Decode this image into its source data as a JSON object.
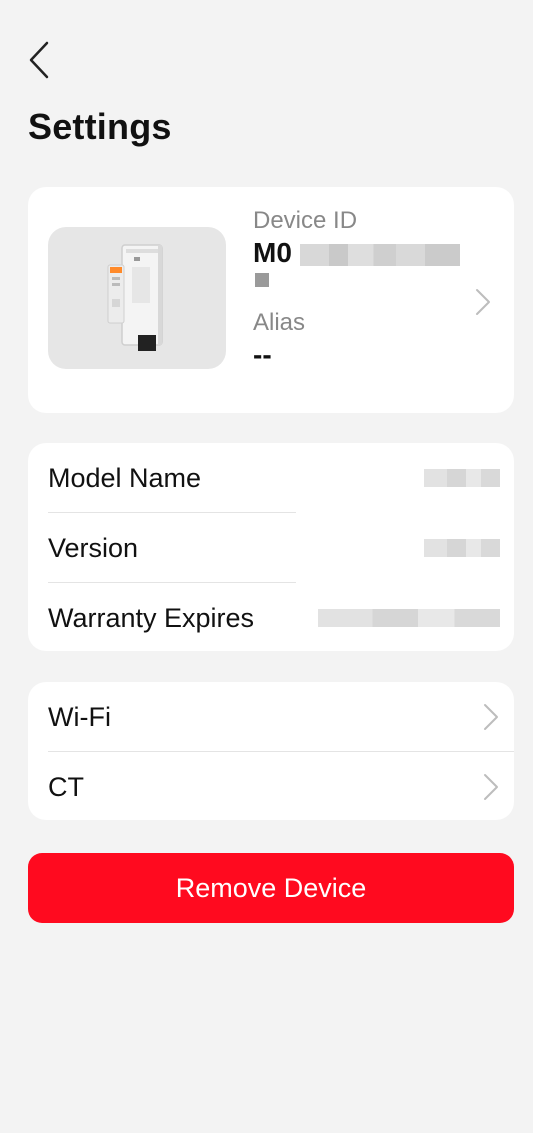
{
  "header": {
    "back_icon": "chevron-left-icon",
    "title": "Settings"
  },
  "device": {
    "id_label": "Device ID",
    "id_value_visible": "M0",
    "alias_label": "Alias",
    "alias_value": "--"
  },
  "info": {
    "rows": [
      {
        "label": "Model Name"
      },
      {
        "label": "Version"
      },
      {
        "label": "Warranty Expires"
      }
    ]
  },
  "nav": {
    "items": [
      {
        "label": "Wi-Fi"
      },
      {
        "label": "CT"
      }
    ]
  },
  "actions": {
    "remove_label": "Remove Device"
  },
  "colors": {
    "accent": "#ff0a1f",
    "background": "#f3f3f3",
    "card": "#ffffff"
  }
}
